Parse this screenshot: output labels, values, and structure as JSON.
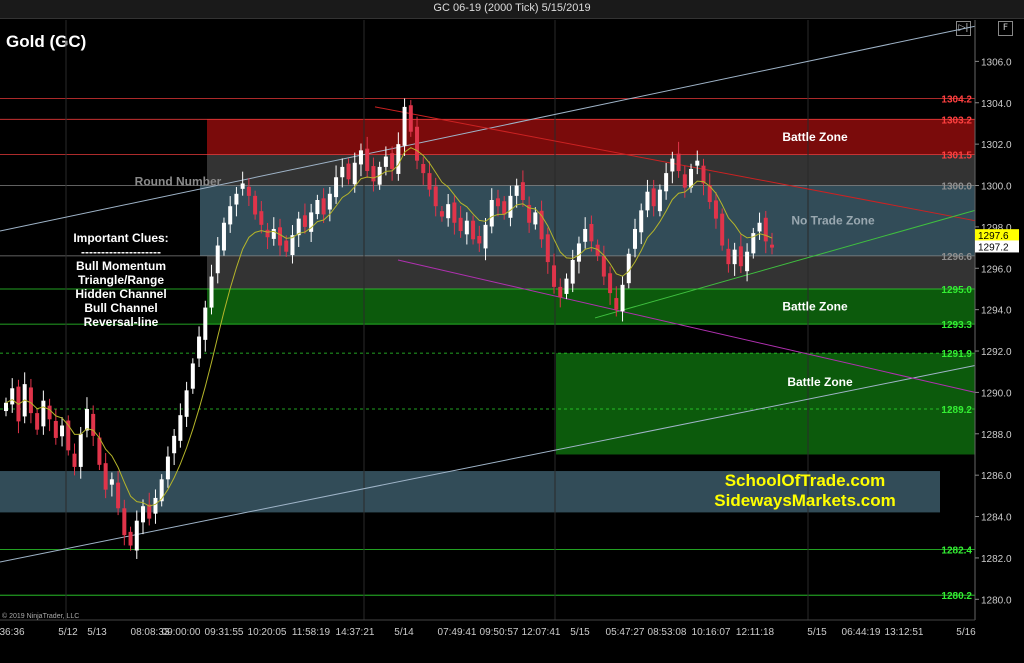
{
  "window": {
    "title": "GC 06-19 (2000 Tick)  5/15/2019",
    "instrument": "Gold (GC)",
    "copyright": "© 2019 NinjaTrader, LLC",
    "buttons": {
      "scroll_end": "▷|",
      "panel": "F"
    }
  },
  "annotations": {
    "clues_title": "Important Clues:",
    "clues_divider": "--------------------",
    "clues": [
      "Bull Momentum",
      "Triangle/Range",
      "Hidden Channel",
      "Bull Channel",
      "Reversal-line"
    ],
    "round_number": "Round Number",
    "no_trade": "No Trade Zone",
    "battle_zone_top": "Battle Zone",
    "battle_zone_mid": "Battle Zone",
    "battle_zone_low": "Battle Zone",
    "promo_1": "SchoolOfTrade.com",
    "promo_2": "SidewaysMarkets.com"
  },
  "colors": {
    "background": "#000000",
    "up_candle": "#ffffff",
    "down_candle": "#e0344a",
    "ma_line": "#b5b52a",
    "red_zone": "#7a0b0b",
    "green_zone": "#0c5a0c",
    "teal_zone": "#3b5967",
    "gray_zone": "#333333",
    "trend_line_blue": "#9fb4c8",
    "trend_line_red": "#cc2222",
    "trend_line_green": "#3fbf3f",
    "trend_line_magenta": "#b030b0"
  },
  "chart_data": {
    "type": "candlestick",
    "title": "GC 06-19 (2000 Tick)  5/15/2019",
    "ylim": [
      1279,
      1308
    ],
    "y_ticks": [
      1280.0,
      1282.0,
      1284.0,
      1286.0,
      1288.0,
      1290.0,
      1292.0,
      1294.0,
      1296.0,
      1298.0,
      1300.0,
      1302.0,
      1304.0,
      1306.0
    ],
    "x_tick_labels": [
      "36:36",
      "5/12",
      "5/13",
      "08:08:33",
      "09:00:00",
      "09:31:55",
      "10:20:05",
      "11:58:19",
      "14:37:21",
      "5/14",
      "07:49:41",
      "09:50:57",
      "12:07:41",
      "5/15",
      "05:47:27",
      "08:53:08",
      "10:16:07",
      "12:11:18",
      "5/15",
      "06:44:19",
      "13:12:51",
      "5/16"
    ],
    "last_price": 1297.2,
    "ma_price": 1297.6,
    "price_levels": [
      {
        "label": "1304.2",
        "value": 1304.2,
        "color": "#ff4040"
      },
      {
        "label": "1303.2",
        "value": 1303.2,
        "color": "#ff4040"
      },
      {
        "label": "1301.5",
        "value": 1301.5,
        "color": "#ff4040"
      },
      {
        "label": "1300.0",
        "value": 1300.0,
        "color": "#909090"
      },
      {
        "label": "1296.6",
        "value": 1296.6,
        "color": "#909090"
      },
      {
        "label": "1295.0",
        "value": 1295.0,
        "color": "#33ee33"
      },
      {
        "label": "1293.3",
        "value": 1293.3,
        "color": "#33ee33"
      },
      {
        "label": "1291.9",
        "value": 1291.9,
        "color": "#33ee33"
      },
      {
        "label": "1289.2",
        "value": 1289.2,
        "color": "#33ee33"
      },
      {
        "label": "1282.4",
        "value": 1282.4,
        "color": "#33ee33"
      },
      {
        "label": "1280.2",
        "value": 1280.2,
        "color": "#33ee33"
      }
    ],
    "zones": [
      {
        "name": "resistance-battle-zone",
        "from": 1301.5,
        "to": 1303.2
      },
      {
        "name": "gray-upper-zone",
        "from": 1300.0,
        "to": 1301.5
      },
      {
        "name": "no-trade-zone",
        "from": 1296.6,
        "to": 1300.0
      },
      {
        "name": "gray-lower-zone",
        "from": 1295.0,
        "to": 1296.6
      },
      {
        "name": "support-battle-zone",
        "from": 1293.3,
        "to": 1295.0
      },
      {
        "name": "lower-battle-zone",
        "from": 1287.0,
        "to": 1291.9
      },
      {
        "name": "hidden-channel-zone",
        "from": 1284.2,
        "to": 1286.2
      }
    ],
    "candle_path": [
      1289.5,
      1290.2,
      1288.6,
      1290.4,
      1289.0,
      1288.2,
      1289.6,
      1288.7,
      1287.8,
      1288.4,
      1287.2,
      1286.4,
      1288.0,
      1289.2,
      1287.9,
      1286.5,
      1285.3,
      1285.8,
      1284.4,
      1283.1,
      1282.6,
      1283.8,
      1284.5,
      1283.9,
      1284.9,
      1285.8,
      1286.9,
      1287.9,
      1288.9,
      1290.1,
      1291.4,
      1292.7,
      1294.1,
      1295.6,
      1297.1,
      1298.2,
      1299.0,
      1299.6,
      1300.1,
      1299.5,
      1298.6,
      1298.1,
      1297.5,
      1297.9,
      1297.1,
      1296.8,
      1297.6,
      1298.4,
      1298.0,
      1298.7,
      1299.3,
      1298.6,
      1299.6,
      1300.4,
      1300.9,
      1300.3,
      1301.1,
      1301.7,
      1300.7,
      1300.2,
      1300.9,
      1301.4,
      1300.8,
      1302.0,
      1303.8,
      1302.6,
      1301.2,
      1300.6,
      1299.8,
      1299.0,
      1298.5,
      1299.1,
      1298.2,
      1297.8,
      1298.3,
      1297.4,
      1297.2,
      1298.1,
      1299.3,
      1299.0,
      1298.6,
      1299.5,
      1300.0,
      1299.3,
      1298.2,
      1298.7,
      1297.4,
      1296.3,
      1295.1,
      1294.6,
      1295.5,
      1296.4,
      1297.2,
      1297.9,
      1297.3,
      1296.6,
      1295.6,
      1294.8,
      1294.0,
      1295.2,
      1296.7,
      1297.9,
      1298.8,
      1299.7,
      1299.0,
      1299.8,
      1300.6,
      1301.3,
      1300.7,
      1299.9,
      1300.8,
      1301.2,
      1300.1,
      1299.2,
      1298.4,
      1297.1,
      1296.2,
      1296.9,
      1296.1,
      1296.8,
      1297.7,
      1298.2,
      1297.3,
      1297.0
    ]
  }
}
